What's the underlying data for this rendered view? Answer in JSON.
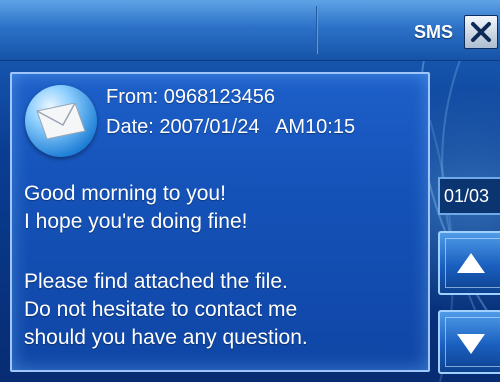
{
  "header": {
    "title": "SMS",
    "close_icon": "close-icon"
  },
  "message": {
    "from_label": "From:",
    "from": "0968123456",
    "date_label": "Date:",
    "date": "2007/01/24",
    "time": "AM10:15",
    "lines": [
      "Good morning to you!",
      "I hope you're doing fine!",
      "",
      "Please find attached the file.",
      "Do not hesitate to contact me",
      "should you have any question."
    ]
  },
  "pager": {
    "current": "01/03",
    "up_icon": "arrow-up-icon",
    "down_icon": "arrow-down-icon"
  },
  "colors": {
    "panel": "#1552b8",
    "header": "#2c72c8",
    "text": "#ffffff"
  }
}
